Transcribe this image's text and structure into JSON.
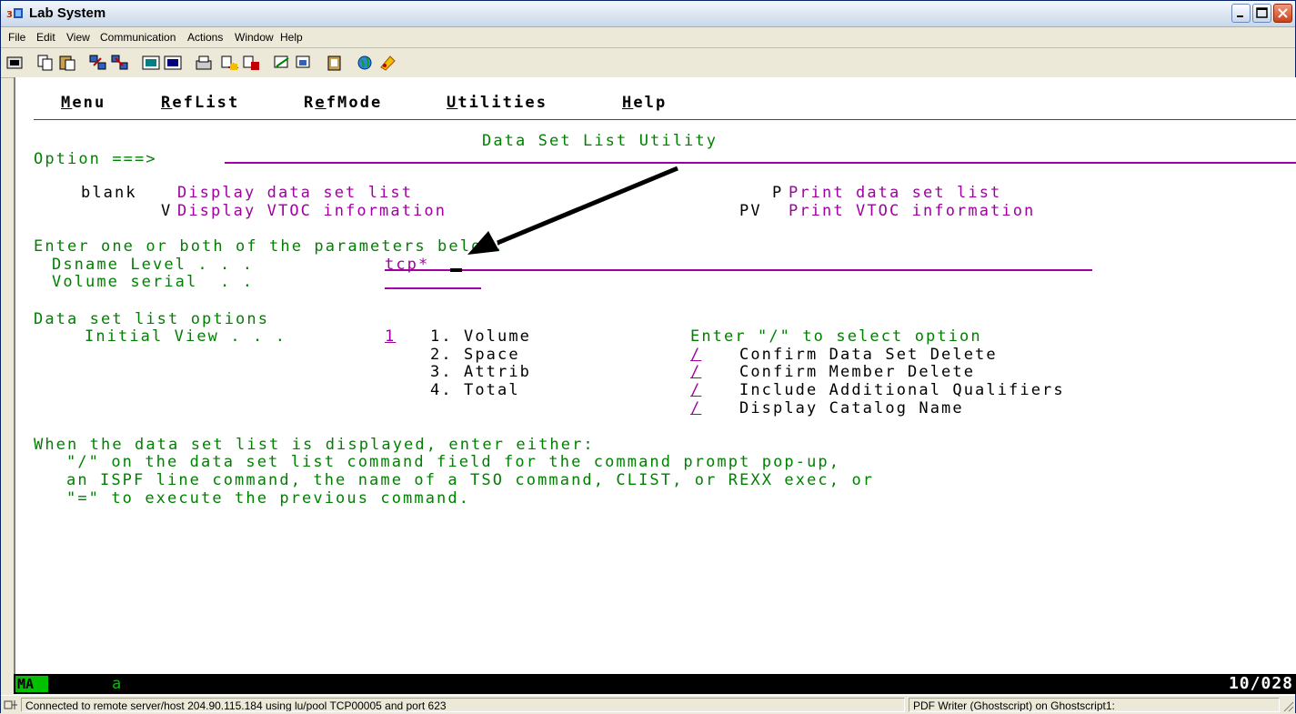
{
  "window": {
    "title": "Lab System"
  },
  "menubar": [
    "File",
    "Edit",
    "View",
    "Communication",
    "Actions",
    "Window",
    "Help"
  ],
  "toolbar_icons": [
    "display-icon",
    "copy-icon",
    "paste-icon",
    "send-icon",
    "receive-icon",
    "macro-play-icon",
    "macro-record-icon",
    "print-screen-icon",
    "transfer-send-icon",
    "transfer-receive-icon",
    "connect-icon",
    "disconnect-icon",
    "clipboard-icon",
    "globe-icon",
    "keymap-icon"
  ],
  "terminal": {
    "action_bar": {
      "menu": "Menu",
      "reflist": "RefList",
      "refmode": "RefMode",
      "utilities": "Utilities",
      "help": "Help"
    },
    "panel_title": "Data Set List Utility",
    "option_label": "Option ===>",
    "options": {
      "blank_key": "blank",
      "blank_desc": "Display data set list",
      "v_key": "V",
      "v_desc": "Display VTOC information",
      "p_key": "P",
      "p_desc": "Print data set list",
      "pv_key": "PV",
      "pv_desc": "Print VTOC information"
    },
    "enter_params": "Enter one or both of the parameters below:",
    "dsname_label": "Dsname Level . . .",
    "dsname_value": "tcp*",
    "volume_label": "Volume serial  . .",
    "volume_value": "",
    "list_options_heading": "Data set list options",
    "initial_view_label": "Initial View . . .",
    "initial_view_value": "1",
    "views": [
      "1. Volume",
      "2. Space",
      "3. Attrib",
      "4. Total"
    ],
    "select_heading": "Enter \"/\" to select option",
    "checks": [
      {
        "mark": "/",
        "label": "Confirm Data Set Delete"
      },
      {
        "mark": "/",
        "label": "Confirm Member Delete"
      },
      {
        "mark": "/",
        "label": "Include Additional Qualifiers"
      },
      {
        "mark": "/",
        "label": "Display Catalog Name"
      }
    ],
    "help_lines": [
      "When the data set list is displayed, enter either:",
      "\"/\" on the data set list command field for the command prompt pop-up,",
      "an ISPF line command, the name of a TSO command, CLIST, or REXX exec, or",
      "\"=\" to execute the previous command."
    ]
  },
  "oia": {
    "mode": "MA",
    "indicator": "a",
    "cursor_position": "10/028"
  },
  "statusbar": {
    "connection": "Connected to remote server/host 204.90.115.184 using lu/pool TCP00005 and port 623",
    "printer": "PDF Writer (Ghostscript) on Ghostscript1:"
  },
  "colors": {
    "field_text": "#008000",
    "input": "#a000a0",
    "oia_bg": "#000000",
    "oia_mode": "#00c000"
  }
}
